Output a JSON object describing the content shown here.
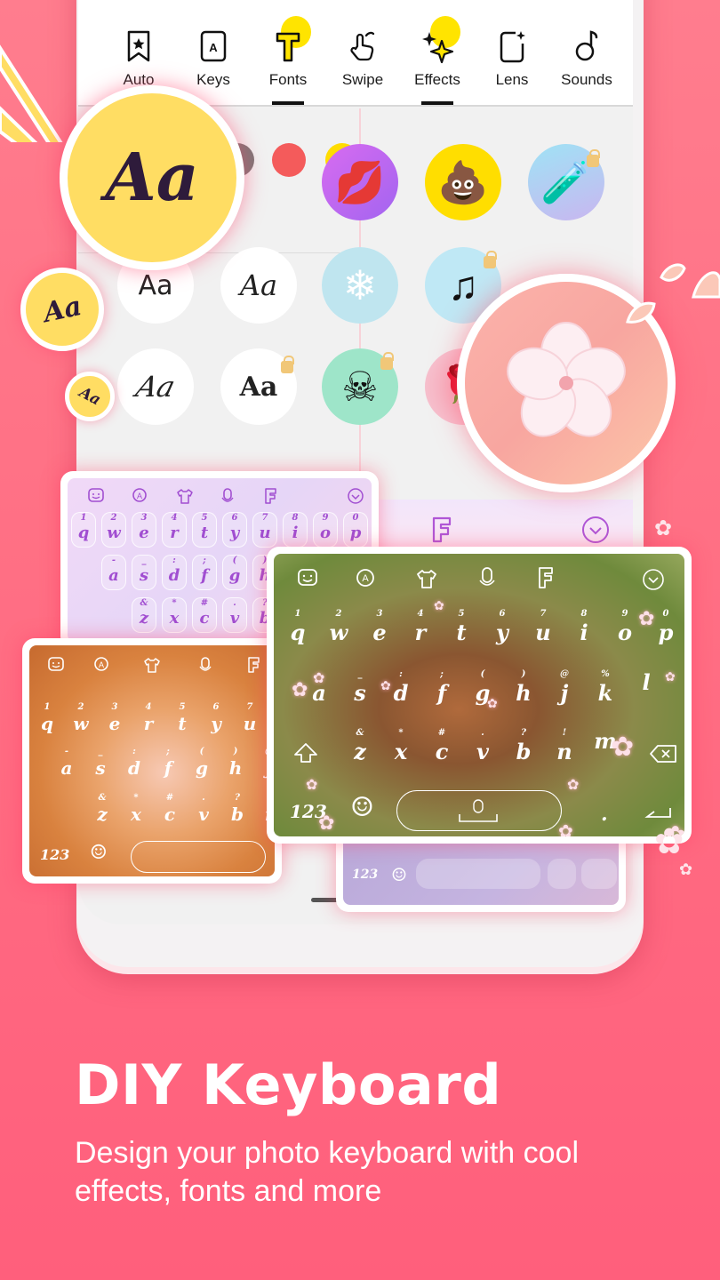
{
  "tabs": [
    {
      "label": "Auto",
      "icon": "bookmark-star-icon",
      "active": false
    },
    {
      "label": "Keys",
      "icon": "key-a-icon",
      "active": false
    },
    {
      "label": "Fonts",
      "icon": "font-t-icon",
      "active": true
    },
    {
      "label": "Swipe",
      "icon": "swipe-hand-icon",
      "active": false
    },
    {
      "label": "Effects",
      "icon": "sparkles-icon",
      "active": true
    },
    {
      "label": "Lens",
      "icon": "lens-sparkle-icon",
      "active": false
    },
    {
      "label": "Sounds",
      "icon": "music-note-icon",
      "active": false
    }
  ],
  "colors": {
    "accent_yellow": "#ffe400",
    "badge_yellow": "#ffdd63",
    "background_pink": "#ff6f84",
    "dot_gray": "#7d7677",
    "dot_red": "#f45b5b",
    "dot_yellow": "#ffdc00",
    "lock_gold": "#f1c778"
  },
  "font_badges": {
    "large": "Aa",
    "medium": "Aa",
    "small": "Aa"
  },
  "font_options": [
    {
      "sample": "Aa",
      "style": "sans",
      "locked": false
    },
    {
      "sample": "Aa",
      "style": "script",
      "locked": false
    },
    {
      "sample": "A",
      "style": "bold",
      "locked": false
    },
    {
      "sample": "Aa",
      "style": "calligraphy",
      "locked": false
    },
    {
      "sample": "Aa",
      "style": "blackletter",
      "locked": true
    },
    {
      "sample": "A",
      "style": "gothic",
      "locked": true
    }
  ],
  "effects": [
    {
      "name": "kiss-lips",
      "glyph": "💋",
      "locked": false
    },
    {
      "name": "poop-emoji",
      "glyph": "💩",
      "locked": false
    },
    {
      "name": "magic-potion",
      "glyph": "🧪",
      "locked": true
    },
    {
      "name": "snowflake",
      "glyph": "❄",
      "locked": false
    },
    {
      "name": "music-notes",
      "glyph": "♫",
      "locked": true
    },
    {
      "name": "skull",
      "glyph": "☠",
      "locked": true
    },
    {
      "name": "rose",
      "glyph": "🌹",
      "locked": false
    }
  ],
  "keyboard": {
    "row1": [
      "q",
      "w",
      "e",
      "r",
      "t",
      "y",
      "u",
      "i",
      "o",
      "p"
    ],
    "row1_nums": [
      "1",
      "2",
      "3",
      "4",
      "5",
      "6",
      "7",
      "8",
      "9",
      "0"
    ],
    "row2": [
      "a",
      "s",
      "d",
      "f",
      "g",
      "h",
      "j",
      "k",
      "l"
    ],
    "row2_syms": [
      "-",
      "_",
      ":",
      ";",
      "(",
      ")",
      "@",
      "%",
      ""
    ],
    "row3": [
      "z",
      "x",
      "c",
      "v",
      "b",
      "n",
      "m"
    ],
    "row3_syms": [
      "&",
      "*",
      "#",
      ".",
      "?",
      "!",
      ""
    ],
    "num_label": "123",
    "period": "."
  },
  "headline": "DIY Keyboard",
  "subheadline": "Design your photo keyboard with cool effects, fonts and more"
}
